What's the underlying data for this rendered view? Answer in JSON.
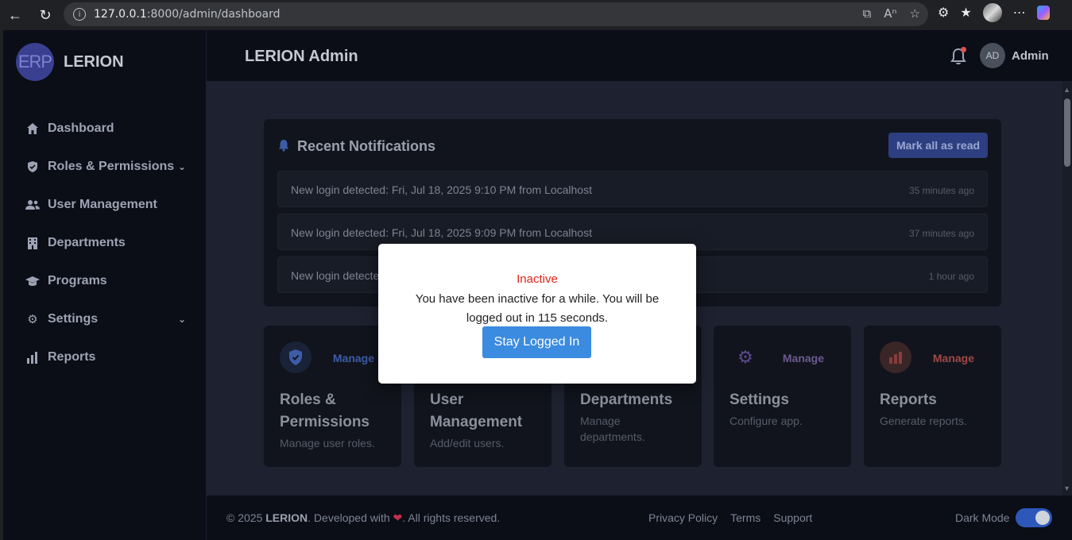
{
  "browser": {
    "url_host": "127.0.0.1",
    "url_path": ":8000/admin/dashboard"
  },
  "sidebar": {
    "logo_mark": "ERP",
    "brand": "LERION",
    "items": [
      {
        "label": "Dashboard",
        "icon": "home-icon"
      },
      {
        "label": "Roles & Permissions",
        "icon": "shield-icon",
        "expandable": true
      },
      {
        "label": "User Management",
        "icon": "users-icon"
      },
      {
        "label": "Departments",
        "icon": "building-icon"
      },
      {
        "label": "Programs",
        "icon": "graduation-cap-icon"
      },
      {
        "label": "Settings",
        "icon": "gear-icon",
        "expandable": true
      },
      {
        "label": "Reports",
        "icon": "bar-chart-icon"
      }
    ]
  },
  "topbar": {
    "title": "LERION Admin",
    "avatar_initials": "AD",
    "user_name": "Admin"
  },
  "notifications": {
    "heading": "Recent Notifications",
    "mark_all_label": "Mark all as read",
    "items": [
      {
        "message": "New login detected: Fri, Jul 18, 2025 9:10 PM from Localhost",
        "time": "35 minutes ago"
      },
      {
        "message": "New login detected: Fri, Jul 18, 2025 9:09 PM from Localhost",
        "time": "37 minutes ago"
      },
      {
        "message": "New login detecte",
        "time": "1 hour ago"
      }
    ]
  },
  "cards": [
    {
      "title": "Roles & Permissions",
      "desc": "Manage user roles.",
      "manage": "Manage",
      "icon": "shield-check-icon",
      "accent": "#3d5ca8"
    },
    {
      "title": "User Management",
      "desc": "Add/edit users.",
      "manage": "",
      "icon": "",
      "accent": ""
    },
    {
      "title": "Departments",
      "desc": "Manage departments.",
      "manage": "",
      "icon": "",
      "accent": ""
    },
    {
      "title": "Settings",
      "desc": "Configure app.",
      "manage": "Manage",
      "icon": "gear-icon",
      "accent": "#6d4fa8"
    },
    {
      "title": "Reports",
      "desc": "Generate reports.",
      "manage": "Manage",
      "icon": "bar-chart-icon",
      "accent": "#a83a3a"
    }
  ],
  "footer": {
    "copyright_prefix": "© 2025 ",
    "brand": "LERION",
    "developed": ". Developed with ",
    "rights": ". All rights reserved.",
    "links": [
      "Privacy Policy",
      "Terms",
      "Support"
    ],
    "dark_mode_label": "Dark Mode",
    "dark_mode_on": true
  },
  "modal": {
    "title": "Inactive",
    "message": "You have been inactive for a while. You will be logged out in 115 seconds.",
    "button": "Stay Logged In"
  }
}
